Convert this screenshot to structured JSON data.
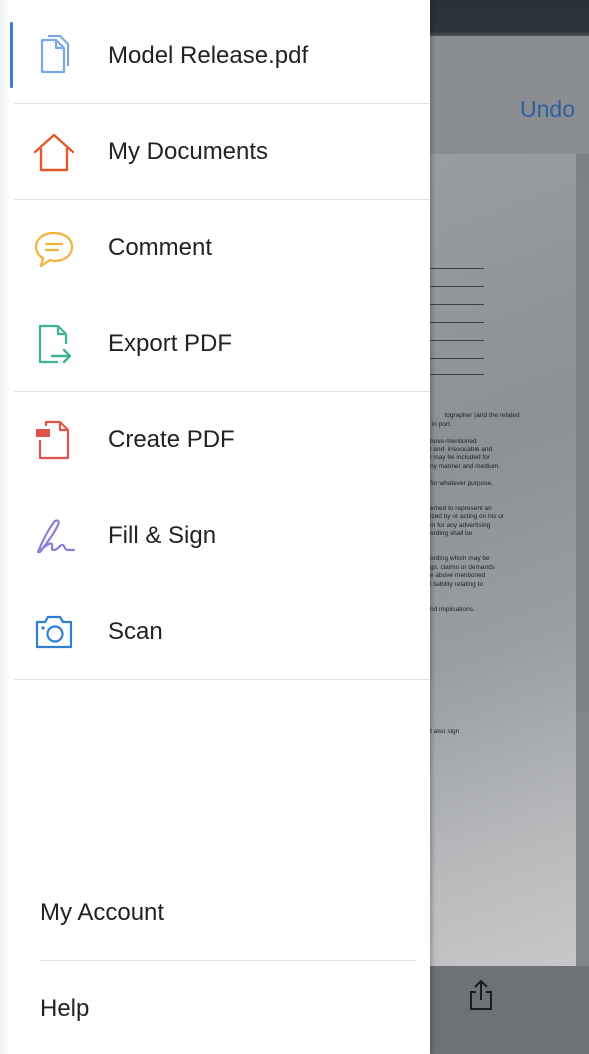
{
  "background": {
    "undo_label": "Undo",
    "doc_text_lines": [
      "tographer (and the related",
      " in port.",
      "",
      "bove-mentioned",
      "l and  irrevocable and",
      "l may be included for",
      "ny manner and medium.",
      "",
      "for whatever purpose,",
      "",
      "",
      "emed to represent an",
      "ized by or acting on his or",
      "m for any advertising",
      "ording shall be",
      "",
      "",
      "ording which may be",
      "gs, claims or demands",
      "e above mentioned",
      "l liability relating to",
      "",
      "",
      "nd implications."
    ],
    "doc_text_tail": "t also sign",
    "share_icon": "share-icon"
  },
  "drawer": {
    "items": [
      {
        "label": "Model Release.pdf",
        "icon": "document-icon",
        "color": "#6fa0e0"
      },
      {
        "label": "My Documents",
        "icon": "home-icon",
        "color": "#e05a2b"
      },
      {
        "label": "Comment",
        "icon": "comment-icon",
        "color": "#f2b13a"
      },
      {
        "label": "Export PDF",
        "icon": "export-pdf-icon",
        "color": "#3fb58f"
      },
      {
        "label": "Create PDF",
        "icon": "create-pdf-icon",
        "color": "#e0554a"
      },
      {
        "label": "Fill & Sign",
        "icon": "fill-sign-icon",
        "color": "#8a7fd6"
      },
      {
        "label": "Scan",
        "icon": "camera-icon",
        "color": "#2f7fd4"
      }
    ],
    "my_account_label": "My Account",
    "help_label": "Help"
  }
}
